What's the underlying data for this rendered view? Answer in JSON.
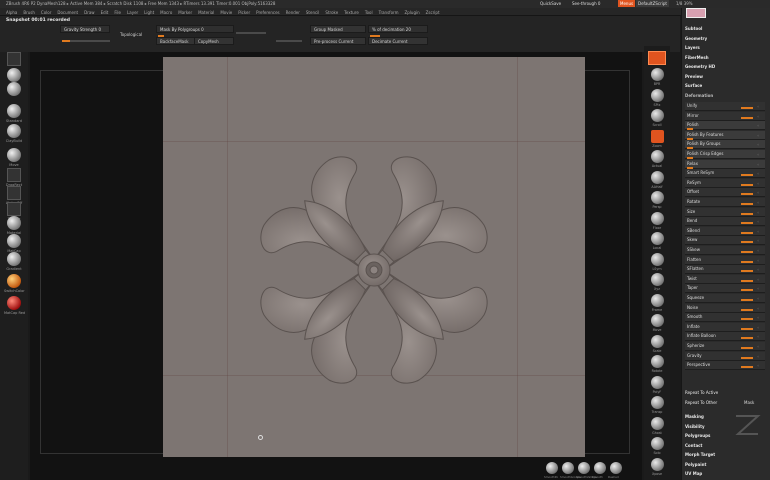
{
  "titlebar": {
    "text": "ZBrush 4R6 P2   DynaMesh128   ▸ Active Mem 384 ▸ Scratch Disk 1108 ▸ Free Mem 1343 ▸ RTimers 13.391 Timer:0.001 ObjPoly:5163328",
    "quicksave": "QuickSave",
    "seethrough": "See-through 0",
    "menus_label": "Menus",
    "defaultscript": "DefaultZScript",
    "counter": "1/8 39%",
    "brand_color": "#e0541f"
  },
  "menubar": {
    "items": [
      "Alpha",
      "Brush",
      "Color",
      "Document",
      "Draw",
      "Edit",
      "File",
      "Layer",
      "Light",
      "Macro",
      "Marker",
      "Material",
      "Movie",
      "Picker",
      "Preferences",
      "Render",
      "Stencil",
      "Stroke",
      "Texture",
      "Tool",
      "Transform",
      "Zplugin",
      "Zscript"
    ]
  },
  "toolbar": {
    "snapshot": "Snapshot 00:01 recorded",
    "gravity": "Gravity Strength 0",
    "topological": "Topological",
    "mask_by_polygroups": "Mask By Polygroups 0",
    "group_masked": "Group Masked",
    "pct_of_decimation": "% of decimation 20",
    "backfacemask": "BackfaceMask",
    "copymesh": "CopyMesh",
    "preprocess_current": "Pre-process Current",
    "decimate_current": "Decimate Current"
  },
  "leftshelf": {
    "items": [
      {
        "label": "",
        "kind": "sq"
      },
      {
        "label": "",
        "kind": "ball"
      },
      {
        "label": "",
        "kind": "ball"
      },
      {
        "label": "Standard",
        "kind": "ball"
      },
      {
        "label": "ClayBuild",
        "kind": "ball"
      },
      {
        "label": "Move",
        "kind": "ball"
      },
      {
        "label": "DragRect",
        "kind": "sq"
      },
      {
        "label": "Alpha Off",
        "kind": "sq"
      },
      {
        "label": "Texture",
        "kind": "sq"
      },
      {
        "label": "Material",
        "kind": "ball"
      },
      {
        "label": "MatCap",
        "kind": "ball"
      },
      {
        "label": "Gradient",
        "kind": "ball"
      },
      {
        "label": "SwitchColor",
        "kind": "ball"
      },
      {
        "label": "MatCap Red",
        "kind": "ball"
      }
    ]
  },
  "rightshelf": {
    "items": [
      "BPR",
      "SPix",
      "Scroll",
      "Zoom",
      "Actual",
      "AAHalf",
      "Persp",
      "Floor",
      "Local",
      "LSym",
      "Xyz",
      "Frame",
      "Move",
      "Scale",
      "Rotate",
      "PolyF",
      "Transp",
      "Ghost",
      "Solo",
      "Xpose"
    ]
  },
  "tray": {
    "headers_top": [
      "Subtool",
      "Geometry",
      "Layers",
      "FiberMesh",
      "Geometry HD",
      "Preview",
      "Surface"
    ],
    "deformation_title": "Deformation",
    "deform_rows": [
      {
        "label": "Unify",
        "hl": false
      },
      {
        "label": "Mirror",
        "hl": false
      },
      {
        "label": "Polish",
        "hl": true
      },
      {
        "label": "Polish By Features",
        "hl": true
      },
      {
        "label": "Polish By Groups",
        "hl": true
      },
      {
        "label": "Polish Crisp Edges",
        "hl": true
      },
      {
        "label": "Relax",
        "hl": true
      },
      {
        "label": "Smart ReSym",
        "hl": false
      },
      {
        "label": "ReSym",
        "hl": false
      },
      {
        "label": "Offset",
        "hl": false
      },
      {
        "label": "Rotate",
        "hl": false
      },
      {
        "label": "Size",
        "hl": false
      },
      {
        "label": "Bend",
        "hl": false
      },
      {
        "label": "SBend",
        "hl": false
      },
      {
        "label": "Skew",
        "hl": false
      },
      {
        "label": "SSkew",
        "hl": false
      },
      {
        "label": "Flatten",
        "hl": false
      },
      {
        "label": "SFlatten",
        "hl": false
      },
      {
        "label": "Twist",
        "hl": false
      },
      {
        "label": "Taper",
        "hl": false
      },
      {
        "label": "Squeeze",
        "hl": false
      },
      {
        "label": "Noise",
        "hl": false
      },
      {
        "label": "Smooth",
        "hl": false
      },
      {
        "label": "Inflate",
        "hl": false
      },
      {
        "label": "Inflate Balloon",
        "hl": false
      },
      {
        "label": "Spherize",
        "hl": false
      },
      {
        "label": "Gravity",
        "hl": false
      },
      {
        "label": "Perspective",
        "hl": false
      }
    ],
    "repeat_active": "Repeat To Active",
    "repeat_other": "Repeat To Other",
    "mask_label": "Mask",
    "headers_bottom": [
      "Masking",
      "Visibility",
      "Polygroups",
      "Contact",
      "Morph Target",
      "Polypaint",
      "UV Map"
    ]
  },
  "bottom": {
    "labels": [
      "SmoothPo",
      "SmoothGroups",
      "SmoothValleys",
      "Smooth",
      "Dashed"
    ]
  }
}
